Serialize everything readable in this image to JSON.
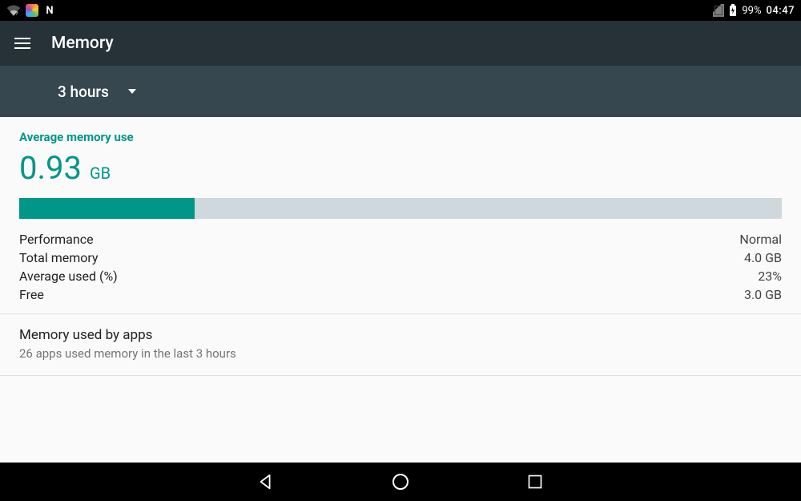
{
  "statusbar": {
    "battery_pct": "99%",
    "clock": "04:47"
  },
  "appbar": {
    "title": "Memory"
  },
  "spinner": {
    "selected": "3 hours"
  },
  "memory": {
    "avg_label": "Average memory use",
    "avg_value": "0.93",
    "avg_unit": "GB",
    "bar_fill_pct": 23,
    "rows": [
      {
        "label": "Performance",
        "value": "Normal"
      },
      {
        "label": "Total memory",
        "value": "4.0 GB"
      },
      {
        "label": "Average used (%)",
        "value": "23%"
      },
      {
        "label": "Free",
        "value": "3.0 GB"
      }
    ]
  },
  "apps": {
    "title": "Memory used by apps",
    "subtitle": "26 apps used memory in the last 3 hours"
  }
}
